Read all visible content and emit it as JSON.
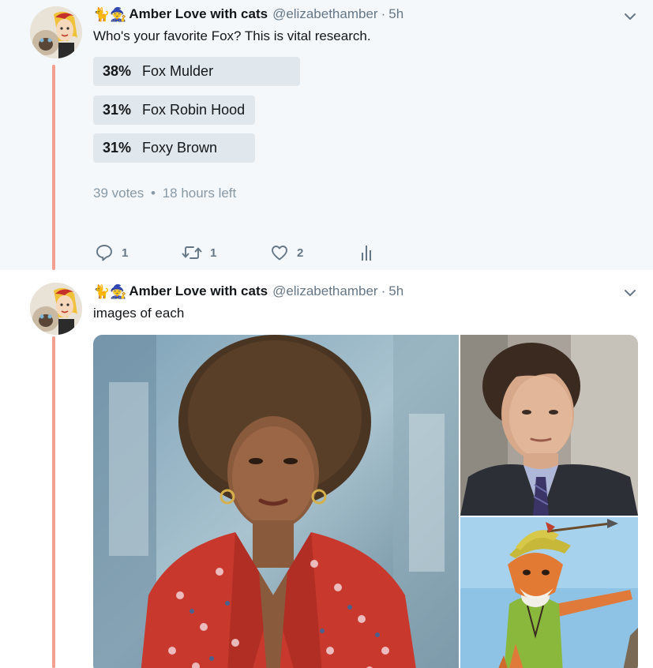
{
  "tweets": [
    {
      "author": {
        "emoji": "🐈🧙",
        "name": "Amber Love with cats",
        "handle": "@elizabethamber",
        "separator": "·",
        "time": "5h"
      },
      "text": "Who's your favorite Fox? This is vital research.",
      "poll": {
        "choices": [
          {
            "percent": "38%",
            "label": "Fox Mulder",
            "share": 0.38
          },
          {
            "percent": "31%",
            "label": "Fox Robin Hood",
            "share": 0.31
          },
          {
            "percent": "31%",
            "label": "Foxy Brown",
            "share": 0.31
          }
        ],
        "votes": "39 votes",
        "bullet": "•",
        "time_left": "18 hours left"
      },
      "actions": {
        "replies": "1",
        "retweets": "1",
        "likes": "2"
      }
    },
    {
      "author": {
        "emoji": "🐈🧙",
        "name": "Amber Love with cats",
        "handle": "@elizabethamber",
        "separator": "·",
        "time": "5h"
      },
      "text": "images of each"
    }
  ],
  "colors": {
    "thread_line": "#f4a090",
    "poll_bar": "#e1e8ed",
    "muted": "#657786",
    "tweet_bg": "#f5f8fa"
  }
}
